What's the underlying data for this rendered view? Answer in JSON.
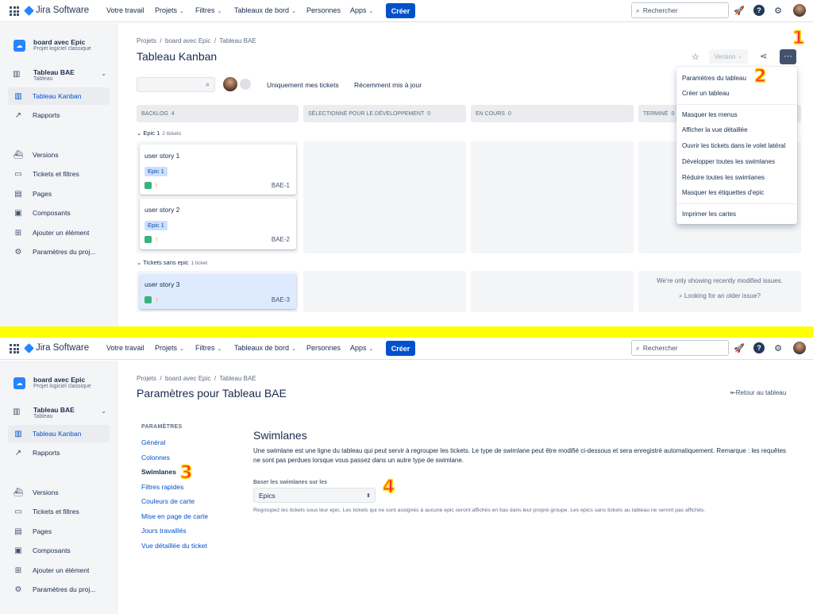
{
  "nav": {
    "product": "Jira Software",
    "your_work": "Votre travail",
    "projects": "Projets",
    "filters": "Filtres",
    "dashboards": "Tableaux de bord",
    "people": "Personnes",
    "apps": "Apps",
    "create": "Créer",
    "search_placeholder": "Rechercher"
  },
  "sidebar": {
    "project_name": "board avec Epic",
    "project_type": "Projet logiciel classique",
    "board_name": "Tableau BAE",
    "board_type": "Tableau",
    "items": [
      {
        "label": "Tableau Kanban"
      },
      {
        "label": "Rapports"
      },
      {
        "label": "Versions"
      },
      {
        "label": "Tickets et filtres"
      },
      {
        "label": "Pages"
      },
      {
        "label": "Composants"
      },
      {
        "label": "Ajouter un élément"
      },
      {
        "label": "Paramètres du proj..."
      }
    ]
  },
  "board": {
    "breadcrumb": [
      "Projets",
      "board avec Epic",
      "Tableau BAE"
    ],
    "title": "Tableau Kanban",
    "version_label": "Version",
    "quick_filters": [
      "Uniquement mes tickets",
      "Récemment mis à jour"
    ],
    "columns": [
      {
        "name": "BACKLOG",
        "count": "4"
      },
      {
        "name": "SÉLECTIONNÉ POUR LE DÉVELOPPEMENT",
        "count": "0"
      },
      {
        "name": "EN COURS",
        "count": "0"
      },
      {
        "name": "TERMINÉ",
        "count": "0"
      }
    ],
    "swimlanes": [
      {
        "name": "Epic 1",
        "count": "2 tickets"
      },
      {
        "name": "Tickets sans epic",
        "count": "1 ticket"
      }
    ],
    "cards": [
      {
        "title": "user story 1",
        "epic": "Epic 1",
        "key": "BAE-1"
      },
      {
        "title": "user story 2",
        "epic": "Epic 1",
        "key": "BAE-2"
      },
      {
        "title": "user story 3",
        "key": "BAE-3"
      }
    ],
    "done_note": "We're only showing recently modified issues.",
    "done_link": "Looking for an older issue?"
  },
  "menu": {
    "items": [
      "Paramètres du tableau",
      "Créer un tableau",
      "Masquer les menus",
      "Afficher la vue détaillée",
      "Ouvrir les tickets dans le volet latéral",
      "Développer toutes les swimlanes",
      "Réduire toutes les swimlanes",
      "Masquer les étiquettes d'epic",
      "Imprimer les cartes"
    ]
  },
  "settings": {
    "breadcrumb": [
      "Projets",
      "board avec Epic",
      "Tableau BAE"
    ],
    "title": "Paramètres pour Tableau BAE",
    "back_link": "Retour au tableau",
    "section_label": "PARAMÈTRES",
    "links": [
      "Général",
      "Colonnes",
      "Swimlanes",
      "Filtres rapides",
      "Couleurs de carte",
      "Mise en page de carte",
      "Jours travaillés",
      "Vue détaillée du ticket"
    ],
    "heading": "Swimlanes",
    "description": "Une swimlane est une ligne du tableau qui peut servir à regrouper les tickets. Le type de swimlane peut être modifié ci-dessous et sera enregistré automatiquement. Remarque : les requêtes ne sont pas perdues lorsque vous passez dans un autre type de swimlane.",
    "field_label": "Baser les swimlanes sur les",
    "field_value": "Epics",
    "help": "Regroupez les tickets sous leur epic. Les tickets qui ne sont assignés à aucune epic seront affichés en bas dans leur propre groupe. Les epics sans tickets au tableau ne seront pas affichés."
  },
  "annotations": [
    "1",
    "2",
    "3",
    "4"
  ],
  "colors": {
    "accent": "#0052cc",
    "separator": "#ffff00",
    "annotation": "#ff2d2d"
  }
}
